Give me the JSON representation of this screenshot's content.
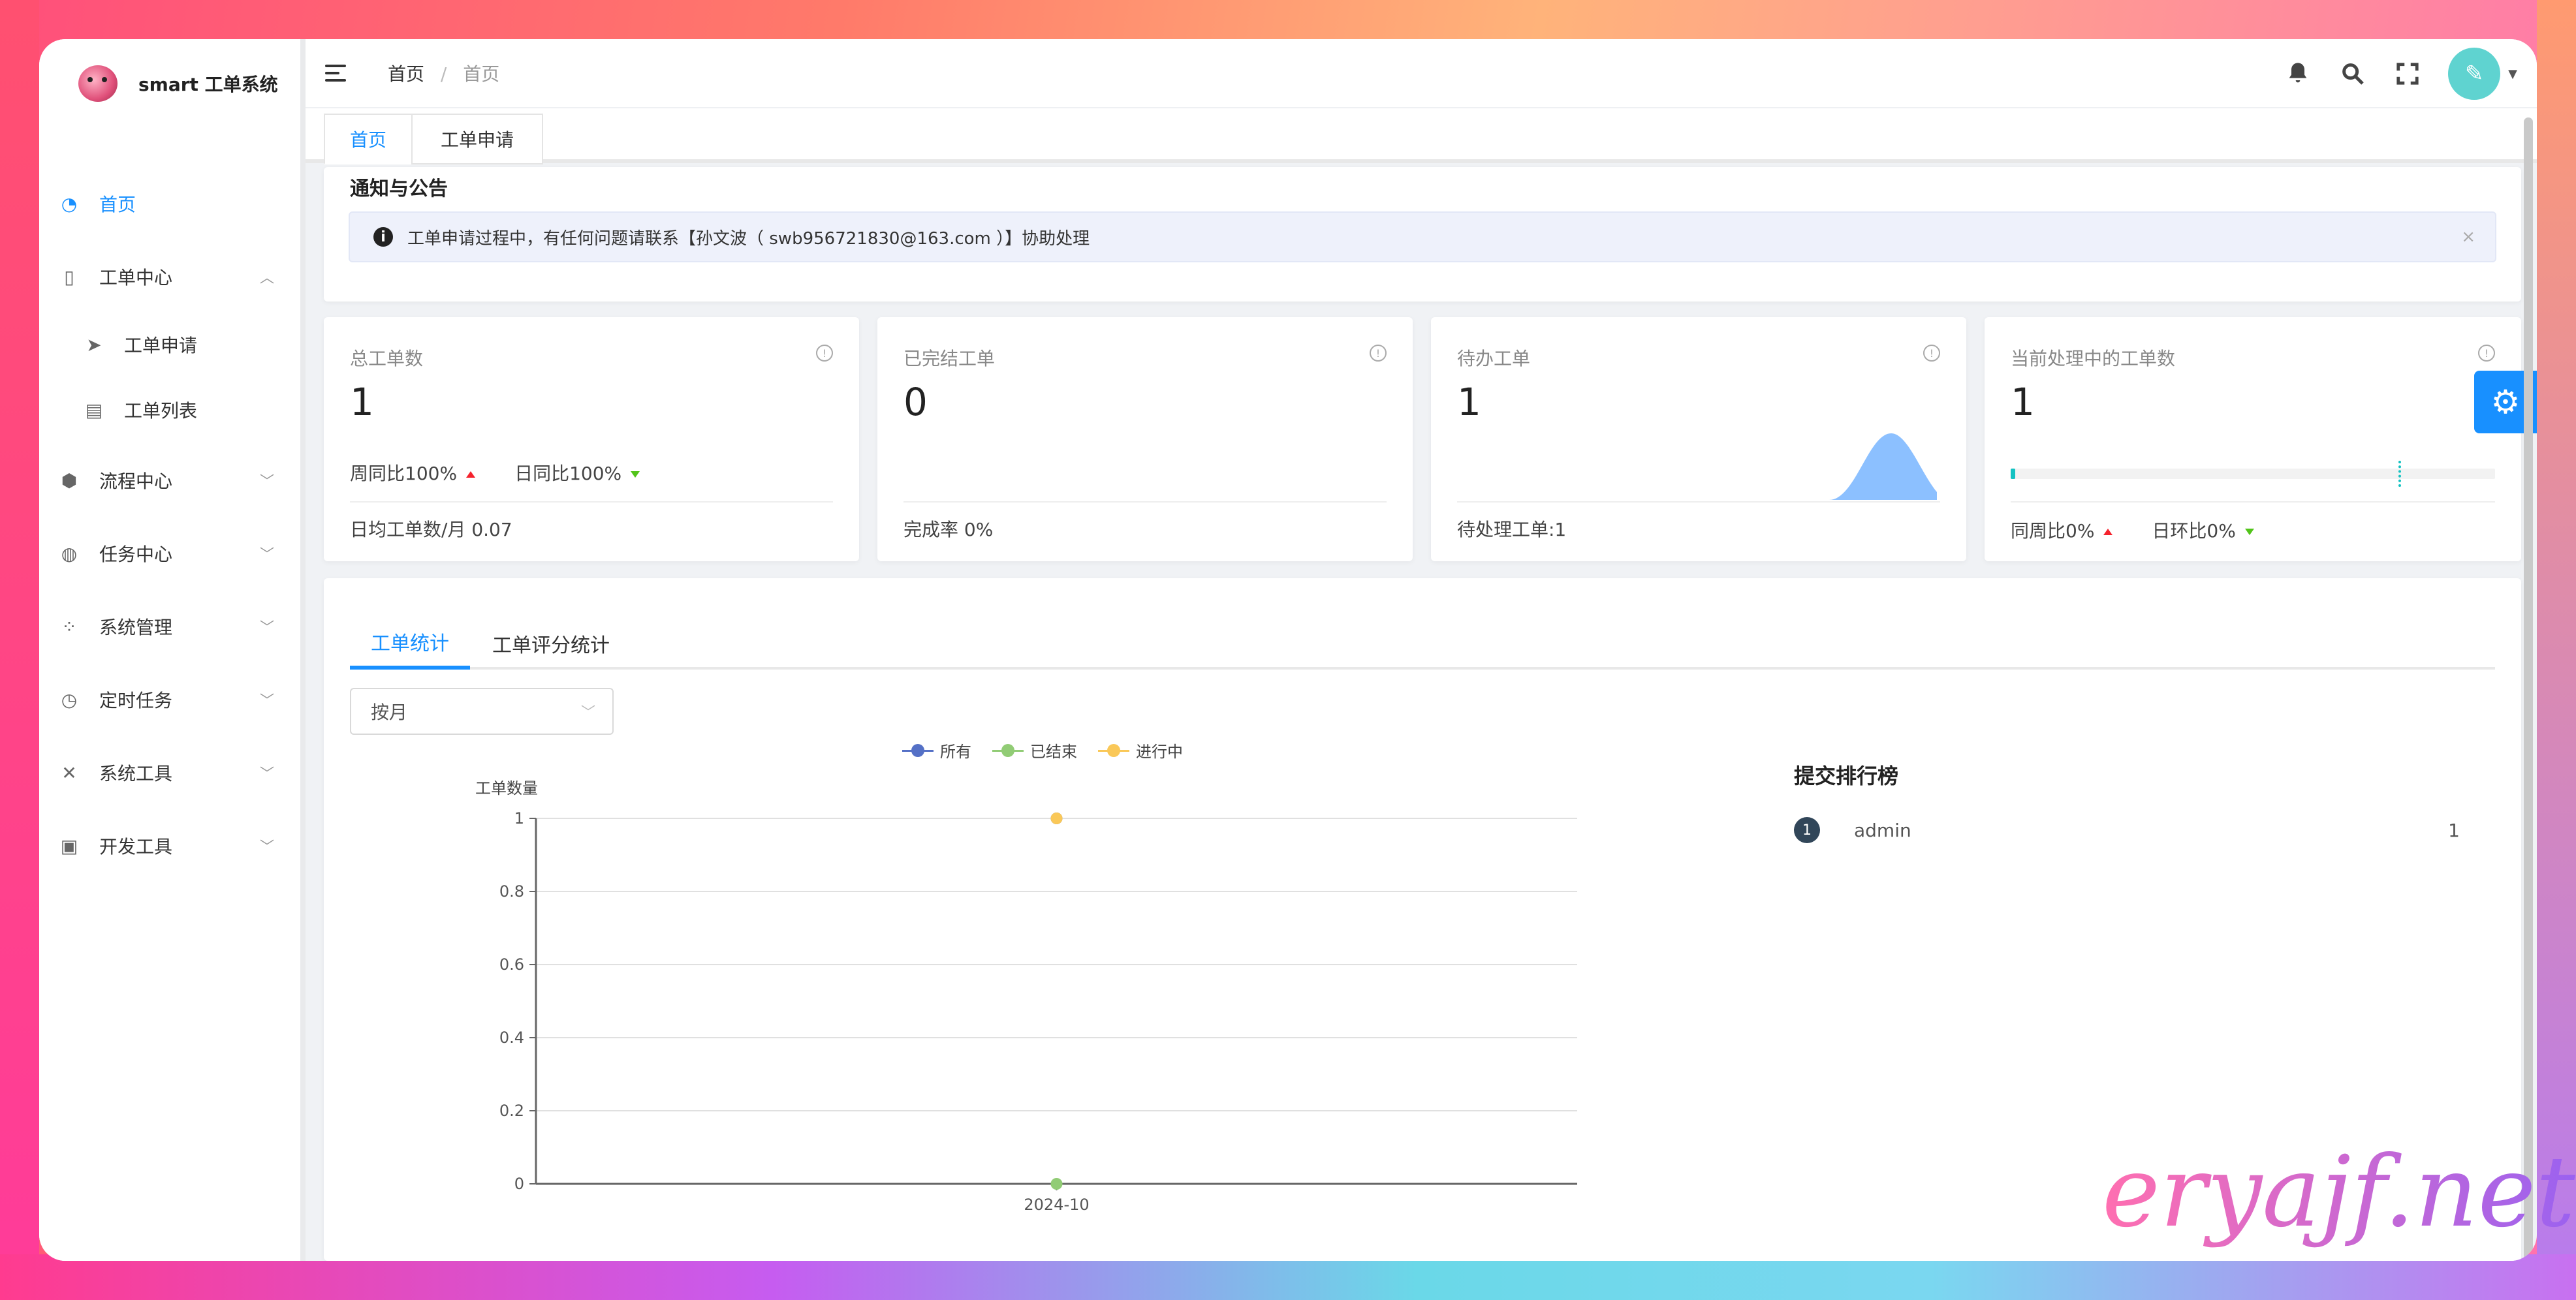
{
  "app": {
    "logo_text": "smart 工单系统"
  },
  "sidebar": {
    "items": [
      {
        "label": "首页",
        "icon": "dashboard-icon"
      },
      {
        "label": "工单中心",
        "icon": "book-icon"
      },
      {
        "label": "工单申请",
        "icon": "send-icon"
      },
      {
        "label": "工单列表",
        "icon": "file-icon"
      },
      {
        "label": "流程中心",
        "icon": "cluster-icon"
      },
      {
        "label": "任务中心",
        "icon": "task-icon"
      },
      {
        "label": "系统管理",
        "icon": "apps-icon"
      },
      {
        "label": "定时任务",
        "icon": "clock-icon"
      },
      {
        "label": "系统工具",
        "icon": "tools-icon"
      },
      {
        "label": "开发工具",
        "icon": "code-icon"
      }
    ]
  },
  "header": {
    "breadcrumb": [
      "首页",
      "首页"
    ],
    "icons": [
      "bell-icon",
      "search-icon",
      "fullscreen-icon",
      "avatar"
    ]
  },
  "tabs": [
    "首页",
    "工单申请"
  ],
  "notice": {
    "title": "通知与公告",
    "message": "工单申请过程中，有任何问题请联系【孙文波（ swb956721830@163.com ）】协助处理",
    "close": "×"
  },
  "stats": [
    {
      "label": "总工单数",
      "value": "1",
      "week": "周同比100%",
      "day": "日同比100%",
      "foot": "日均工单数/月 0.07"
    },
    {
      "label": "已完结工单",
      "value": "0",
      "foot": "完成率 0%"
    },
    {
      "label": "待办工单",
      "value": "1",
      "foot": "待处理工单:1"
    },
    {
      "label": "当前处理中的工单数",
      "value": "1",
      "progress": 0.01,
      "target": 0.8,
      "week": "同周比0%",
      "day": "日环比0%"
    }
  ],
  "stats_section": {
    "tabs": [
      "工单统计",
      "工单评分统计"
    ],
    "select_value": "按月",
    "legend": [
      {
        "name": "所有",
        "color": "#5470c6"
      },
      {
        "name": "已结束",
        "color": "#91cc75"
      },
      {
        "name": "进行中",
        "color": "#fac858"
      }
    ]
  },
  "chart_data": {
    "type": "line",
    "ylabel": "工单数量",
    "categories": [
      "2024-10"
    ],
    "yticks": [
      "0",
      "0.2",
      "0.4",
      "0.6",
      "0.8",
      "1"
    ],
    "ylim": [
      0,
      1
    ],
    "series": [
      {
        "name": "所有",
        "values": [
          1
        ],
        "color": "#5470c6"
      },
      {
        "name": "已结束",
        "values": [
          0
        ],
        "color": "#91cc75"
      },
      {
        "name": "进行中",
        "values": [
          1
        ],
        "color": "#fac858"
      }
    ]
  },
  "ranking": {
    "title": "提交排行榜",
    "rows": [
      {
        "rank": "1",
        "name": "admin",
        "value": "1"
      }
    ]
  },
  "watermark": "eryajf.net"
}
